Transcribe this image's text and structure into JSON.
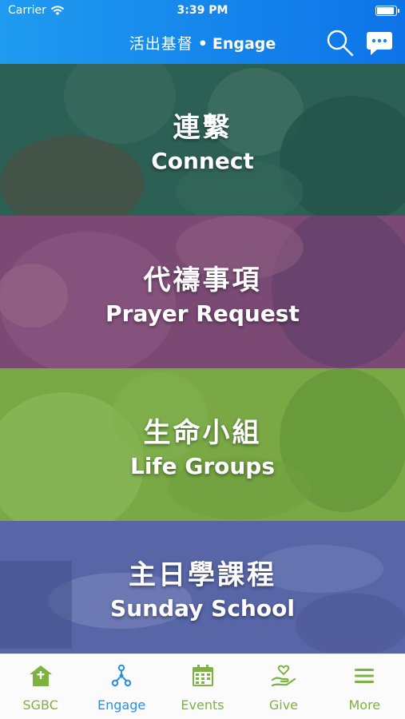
{
  "status_bar": {
    "carrier": "Carrier",
    "time": "3:39 PM"
  },
  "nav": {
    "title_zh": "活出基督",
    "separator": "•",
    "title_en": "Engage",
    "search_icon": "search-icon",
    "chat_icon": "chat-bubble-icon"
  },
  "panels": [
    {
      "label_zh": "連繫",
      "label_en": "Connect",
      "color": "#2f6357"
    },
    {
      "label_zh": "代禱事項",
      "label_en": "Prayer Request",
      "color": "#7c4b76"
    },
    {
      "label_zh": "生命小組",
      "label_en": "Life Groups",
      "color": "#7aa945"
    },
    {
      "label_zh": "主日學課程",
      "label_en": "Sunday School",
      "color": "#5a68aa"
    }
  ],
  "tabbar": {
    "items": [
      {
        "label": "SGBC",
        "icon": "church-icon",
        "active": false
      },
      {
        "label": "Engage",
        "icon": "people-network-icon",
        "active": true
      },
      {
        "label": "Events",
        "icon": "calendar-icon",
        "active": false
      },
      {
        "label": "Give",
        "icon": "give-hand-heart-icon",
        "active": false
      },
      {
        "label": "More",
        "icon": "menu-icon",
        "active": false
      }
    ],
    "active_color": "#2a8fe0",
    "inactive_color": "#7cb342"
  }
}
